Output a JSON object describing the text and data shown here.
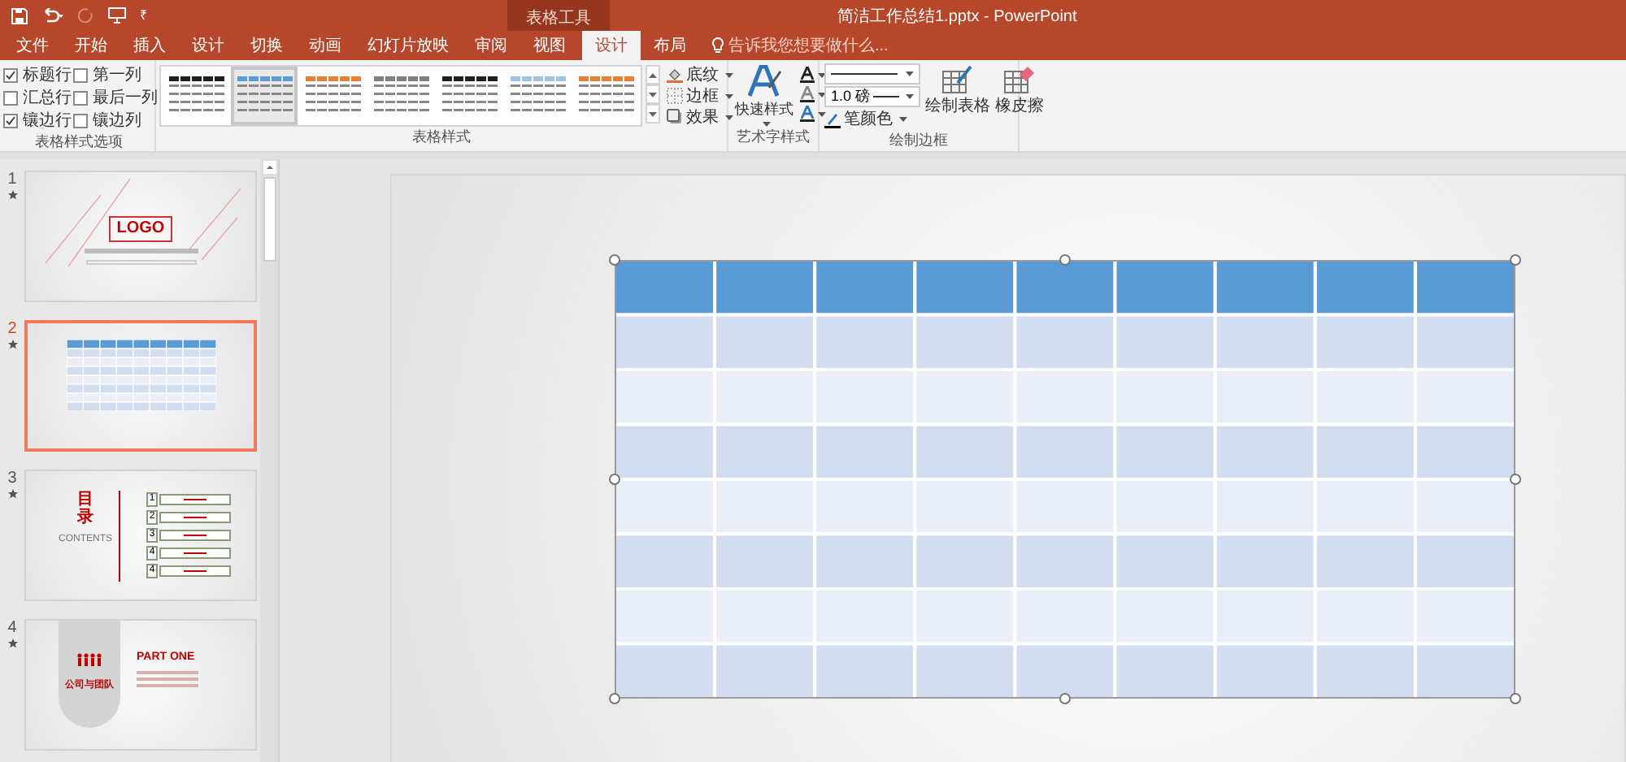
{
  "quick_access": {
    "customize": "₹"
  },
  "title_bar": {
    "context_group": "表格工具",
    "title": "简洁工作总结1.pptx - PowerPoint"
  },
  "tabs": [
    {
      "label": "文件",
      "selected": false
    },
    {
      "label": "开始",
      "selected": false
    },
    {
      "label": "插入",
      "selected": false
    },
    {
      "label": "设计",
      "selected": false
    },
    {
      "label": "切换",
      "selected": false
    },
    {
      "label": "动画",
      "selected": false
    },
    {
      "label": "幻灯片放映",
      "selected": false
    },
    {
      "label": "审阅",
      "selected": false
    },
    {
      "label": "视图",
      "selected": false
    },
    {
      "label": "设计",
      "selected": true
    },
    {
      "label": "布局",
      "selected": false
    }
  ],
  "tell_me": {
    "placeholder": "告诉我您想要做什么..."
  },
  "table_style_options": {
    "label": "表格样式选项",
    "items": [
      {
        "kind": "header_row",
        "label": "标题行",
        "checked": true
      },
      {
        "kind": "first_column",
        "label": "第一列",
        "checked": false
      },
      {
        "kind": "total_row",
        "label": "汇总行",
        "checked": false
      },
      {
        "kind": "last_column",
        "label": "最后一列",
        "checked": false
      },
      {
        "kind": "banded_rows",
        "label": "镶边行",
        "checked": true
      },
      {
        "kind": "banded_columns",
        "label": "镶边列",
        "checked": false
      }
    ]
  },
  "table_styles": {
    "label": "表格样式",
    "styles": [
      {
        "color": "#1f1f1f",
        "selected": false
      },
      {
        "color": "#5b9bd5",
        "selected": true
      },
      {
        "color": "#ed7d31",
        "selected": false
      },
      {
        "color": "#7f7f7f",
        "selected": false
      },
      {
        "color": "#1f1f1f",
        "selected": false
      },
      {
        "color": "#9dc3e6",
        "selected": false
      },
      {
        "color": "#ed7d31",
        "selected": false
      }
    ],
    "buttons": [
      "底纹",
      "边框",
      "效果"
    ]
  },
  "wordart_styles": {
    "label": "艺术字样式",
    "quick_styles": "快速样式"
  },
  "draw_borders": {
    "label": "绘制边框",
    "pen_weight": "1.0 磅",
    "pen_color": "笔颜色",
    "draw_table": "绘制表格",
    "eraser": "橡皮擦"
  },
  "slides": [
    {
      "number": "1",
      "kind": "title",
      "selected": false,
      "logo": "LOGO"
    },
    {
      "number": "2",
      "kind": "table",
      "selected": true
    },
    {
      "number": "3",
      "kind": "toc",
      "selected": false,
      "heading": "目录",
      "subheading": "CONTENTS",
      "entries": [
        "1",
        "2",
        "3",
        "4",
        "4"
      ]
    },
    {
      "number": "4",
      "kind": "section",
      "selected": false,
      "part": "PART ONE",
      "caption": "公司与团队"
    }
  ]
}
